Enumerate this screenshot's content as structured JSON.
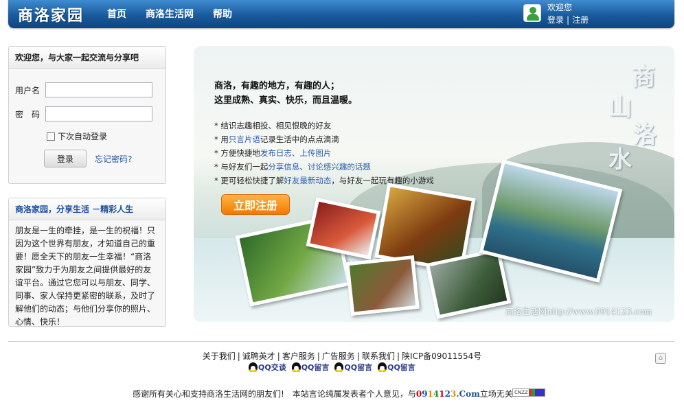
{
  "header": {
    "logo": "商洛家园",
    "nav": [
      "首页",
      "商洛生活网",
      "帮助"
    ],
    "welcome": "欢迎您",
    "login_link": "登录",
    "register_link": "注册"
  },
  "login_box": {
    "title": "欢迎您，与大家一起交流与分享吧",
    "username_label": "用户名",
    "password_label": "密　码",
    "remember_label": "下次自动登录",
    "login_button": "登录",
    "forgot_link": "忘记密码?"
  },
  "about_box": {
    "title": "商洛家园，分享生活 －精彩人生",
    "text": "朋友是一生的牵挂，是一生的祝福！只因为这个世界有朋友，才知道自己的重要！愿全天下的朋友一生幸福！“商洛家园”致力于为朋友之间提供最好的友谊平台。通过它您可以与朋友、同学、同事、家人保持更紧密的联系，及时了解他们的动态；与他们分享你的照片、心情、快乐！"
  },
  "banner": {
    "headline_1": "商洛，有趣的地方，有趣的人；",
    "headline_2": "这里成熟、真实、快乐，而且温暖。",
    "features": [
      {
        "pre": "* 结识志趣相投、相见恨晚的好友",
        "em": "",
        "post": ""
      },
      {
        "pre": "* 用",
        "em": "只言片语",
        "post": "记录生活中的点点滴滴"
      },
      {
        "pre": "* 方便快捷地",
        "em": "发布日志、上传图片",
        "post": ""
      },
      {
        "pre": "* 与好友们一起",
        "em": "分享信息、讨论感兴趣的话题",
        "post": ""
      },
      {
        "pre": "* 更可轻松快捷了解",
        "em": "好友最新动态",
        "post": "，与好友一起玩有趣的小游戏"
      }
    ],
    "register_button": "立即注册",
    "calligraphy": [
      "商",
      "山",
      "洛",
      "水"
    ],
    "watermark": "商洛生活网http://www.0914123.com"
  },
  "footer": {
    "links": [
      "关于我们",
      "诚聘英才",
      "客户服务",
      "广告服务",
      "联系我们",
      "陕ICP备09011554号"
    ],
    "qq": [
      "QQ交谈",
      "QQ留言",
      "QQ留言",
      "QQ留言"
    ],
    "thanks": "感谢所有关心和支持商洛生活网的朋友们!　本站言论纯属发表者个人意见，与",
    "brand": [
      "0",
      "9",
      "1",
      "4",
      "1",
      "2",
      "3",
      ".Com"
    ],
    "thanks_tail": "立场无关!",
    "cnzz": "CNZZ"
  }
}
